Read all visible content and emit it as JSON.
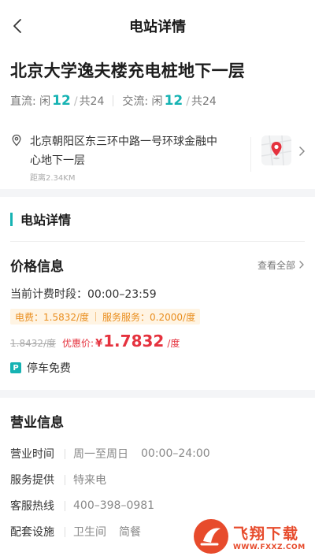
{
  "nav": {
    "title": "电站详情"
  },
  "station": {
    "name": "北京大学逸夫楼充电桩地下一层",
    "dc_label": "直流: 闲",
    "dc_free": "12",
    "dc_total": "共24",
    "ac_label": "交流: 闲",
    "ac_free": "12",
    "ac_total": "共24"
  },
  "address": {
    "line1": "北京朝阳区东三环中路一号环球金融中",
    "line2": "心地下一层",
    "distance": "距离2.34KM"
  },
  "section": {
    "title": "电站详情"
  },
  "price": {
    "heading": "价格信息",
    "view_all": "查看全部",
    "period": "当前计费时段：00:00–23:59",
    "elec_fee": "电费：1.5832/度",
    "service_fee": "服务服务：0.2000/度",
    "original": "1.8432/度",
    "discount_label": "优惠价:",
    "currency": "¥",
    "discount_value": "1.7832",
    "unit": "/度",
    "parking_icon": "P",
    "parking": "停车免费"
  },
  "business": {
    "heading": "营业信息",
    "hours_label": "营业时间",
    "hours_days": "周一至周日",
    "hours_time": "00:00–24:00",
    "provider_label": "服务提供",
    "provider": "特来电",
    "hotline_label": "客服热线",
    "hotline": "400–398–0981",
    "facilities_label": "配套设施",
    "facility_1": "卫生间",
    "facility_2": "简餐"
  },
  "watermark": {
    "text_cn": "飞翔下载",
    "text_en": "WWW.FXXZ.COM"
  },
  "colors": {
    "accent": "#16b3b3",
    "price_red": "#e5323e",
    "fee_orange": "#e98d1d"
  }
}
